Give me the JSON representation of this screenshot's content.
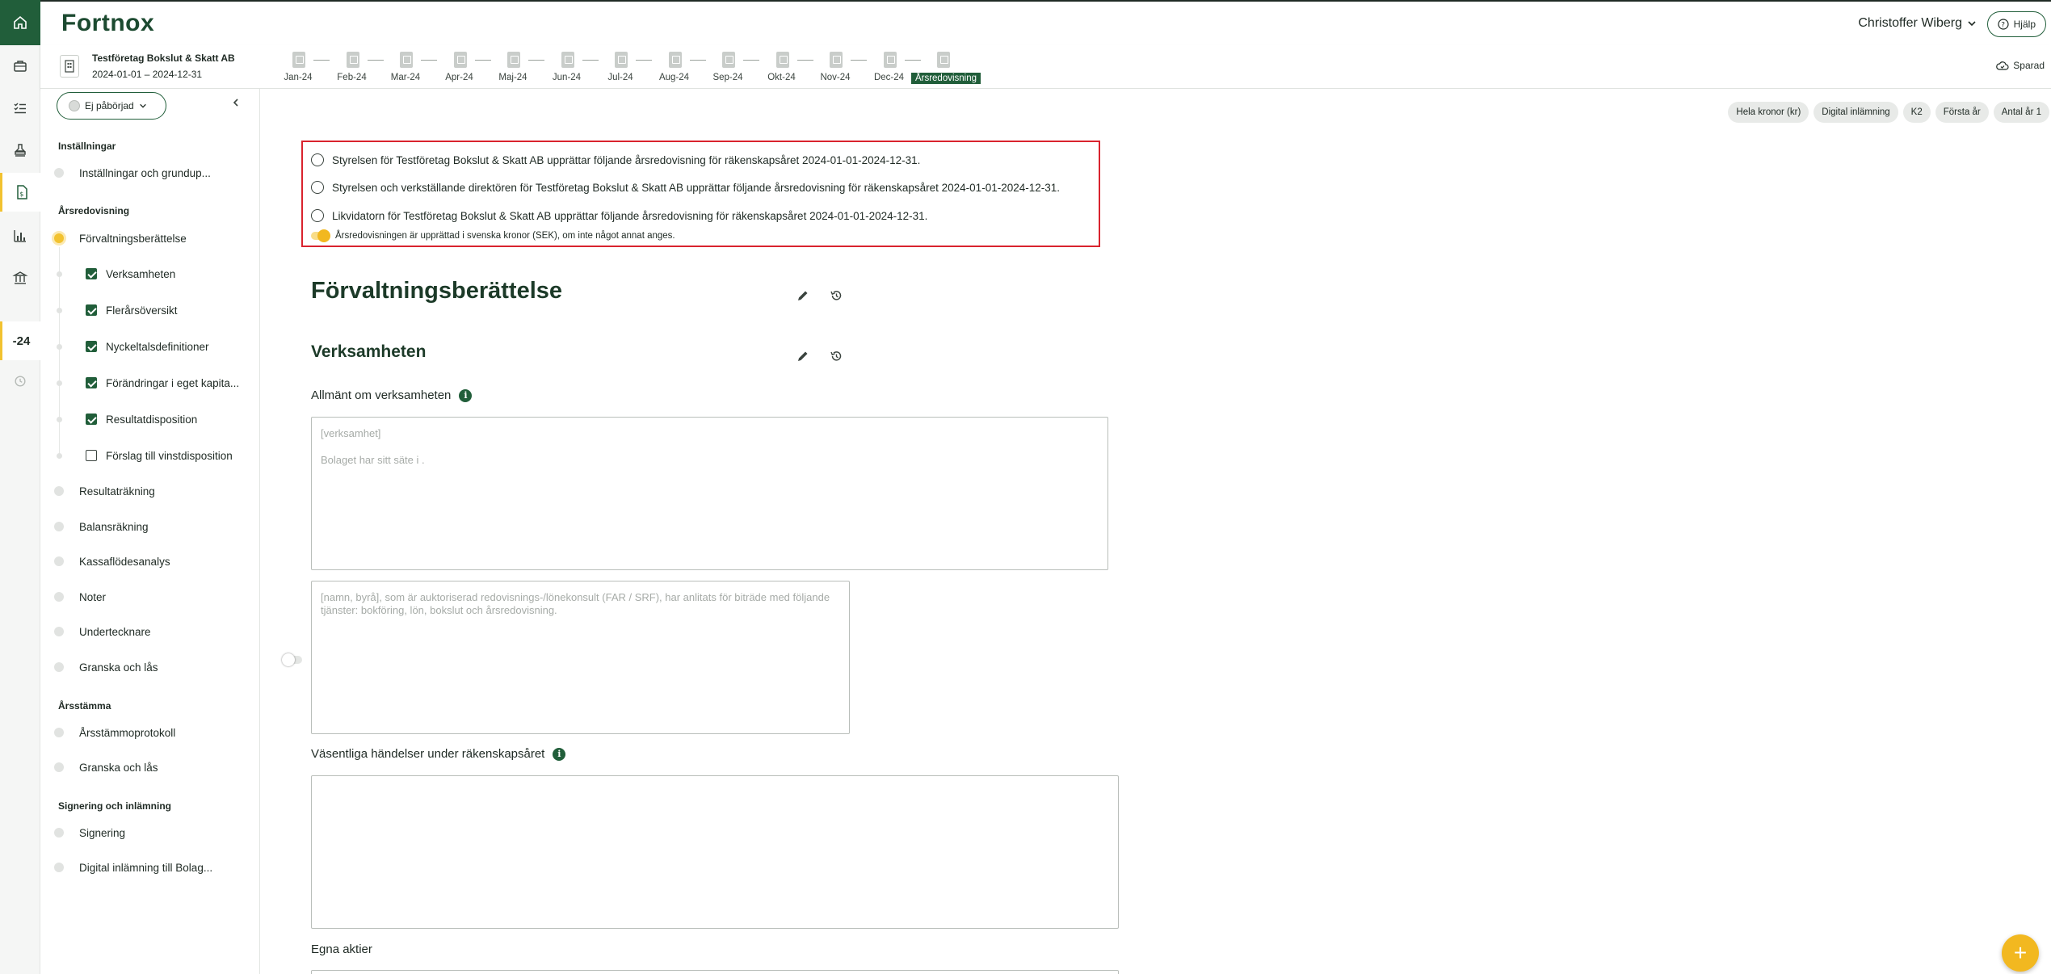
{
  "header": {
    "logo": "Fortnox",
    "user_name": "Christoffer Wiberg",
    "help_label": "Hjälp"
  },
  "company": {
    "name": "Testföretag Bokslut & Skatt AB",
    "period": "2024-01-01 – 2024-12-31"
  },
  "months": [
    "Jan-24",
    "Feb-24",
    "Mar-24",
    "Apr-24",
    "Maj-24",
    "Jun-24",
    "Jul-24",
    "Aug-24",
    "Sep-24",
    "Okt-24",
    "Nov-24",
    "Dec-24",
    "Årsredovisning"
  ],
  "saved_label": "Sparad",
  "rail": {
    "year_label": "-24"
  },
  "sidebar": {
    "status": "Ej påbörjad",
    "sections": {
      "settings": "Inställningar",
      "annual_report": "Årsredovisning",
      "agm": "Årsstämma",
      "signing": "Signering och inlämning"
    },
    "items": {
      "settings_item": "Inställningar och grundup...",
      "management_report": "Förvaltningsberättelse",
      "operations": "Verksamheten",
      "multi_year": "Flerårsöversikt",
      "key_ratios": "Nyckeltalsdefinitioner",
      "equity_changes": "Förändringar i eget kapita...",
      "profit_disposition": "Resultatdisposition",
      "proposal_disposition": "Förslag till vinstdisposition",
      "income_statement": "Resultaträkning",
      "balance_sheet": "Balansräkning",
      "cash_flow": "Kassaflödesanalys",
      "notes": "Noter",
      "signatories": "Undertecknare",
      "review_lock": "Granska och lås",
      "agm_minutes": "Årsstämmoprotokoll",
      "agm_review_lock": "Granska och lås",
      "signing": "Signering",
      "digital_submission": "Digital inlämning till Bolag..."
    }
  },
  "chips": [
    "Hela kronor (kr)",
    "Digital inlämning",
    "K2",
    "Första år",
    "Antal år 1"
  ],
  "preparer_options": [
    "Styrelsen för Testföretag Bokslut & Skatt AB upprättar följande årsredovisning för räkenskapsåret 2024-01-01-2024-12-31.",
    "Styrelsen och verkställande direktören för Testföretag Bokslut & Skatt AB upprättar följande årsredovisning för räkenskapsåret 2024-01-01-2024-12-31.",
    "Likvidatorn för Testföretag Bokslut & Skatt AB upprättar följande årsredovisning för räkenskapsåret 2024-01-01-2024-12-31."
  ],
  "currency_toggle_label": "Årsredovisningen är upprättad i svenska kronor (SEK), om inte något annat anges.",
  "main": {
    "title": "Förvaltningsberättelse",
    "section_title": "Verksamheten",
    "general_label": "Allmänt om verksamheten",
    "general_placeholder_1": "[verksamhet]",
    "general_placeholder_2": "Bolaget har sitt säte i .",
    "consultant_placeholder": "[namn, byrå], som är auktoriserad redovisnings-/lönekonsult (FAR / SRF), har anlitats för biträde med följande tjänster: bokföring, lön, bokslut och årsredovisning.",
    "events_label": "Väsentliga händelser under räkenskapsåret",
    "own_shares_label": "Egna aktier"
  },
  "colors": {
    "brand_green": "#215e3a",
    "accent_yellow": "#f2b820",
    "highlight_red": "#d9232e"
  }
}
